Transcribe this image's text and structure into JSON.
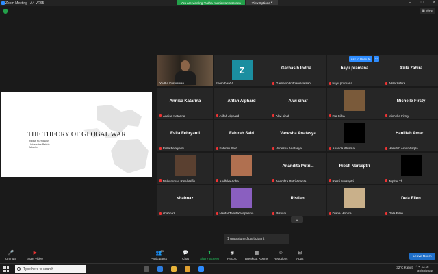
{
  "window": {
    "title": "Zoom Meeting - A4-VR65"
  },
  "banner": {
    "viewing": "You are viewing Yudha Kurniawan's screen",
    "view_options": "View Options"
  },
  "window_controls": {
    "minimize": "–",
    "maximize": "□",
    "close": "×"
  },
  "top_right": {
    "view_label": "View"
  },
  "slide": {
    "title": "THE THEORY OF GLOBAL WAR",
    "author_lines": [
      "Yudha Kurniawan",
      "Universitas Bakrie",
      "Jakarta"
    ]
  },
  "participants": [
    {
      "display": "",
      "label": "Yudha Kurniawan",
      "muted": false,
      "kind": "video",
      "active": true
    },
    {
      "display": "Z",
      "label": "zoom baa04",
      "muted": false,
      "kind": "avatar"
    },
    {
      "display": "Garnasih Indria...",
      "label": "Garnasih Indriani Hafsah",
      "muted": true,
      "kind": "name"
    },
    {
      "display": "bayu pramana",
      "label": "bayu pramana",
      "muted": true,
      "kind": "name"
    },
    {
      "display": "Azila Zahira",
      "label": "Azila Zahira",
      "muted": true,
      "kind": "name"
    },
    {
      "display": "Annisa Katarina",
      "label": "Annisa Katarina",
      "muted": true,
      "kind": "name"
    },
    {
      "display": "Afifah Alphard",
      "label": "Afifah Alphard",
      "muted": true,
      "kind": "name"
    },
    {
      "display": "Alwi sihaf",
      "label": "Alwi sihaf",
      "muted": true,
      "kind": "name"
    },
    {
      "display": "",
      "label": "Ria Silva",
      "muted": true,
      "kind": "photo",
      "photo": "#7a5a3a"
    },
    {
      "display": "Michelle Firsty",
      "label": "Michelle Firsty",
      "muted": true,
      "kind": "name"
    },
    {
      "display": "Evita Febryanti",
      "label": "Evita Febryanti",
      "muted": true,
      "kind": "name"
    },
    {
      "display": "Fahirah Said",
      "label": "Fahirah Said",
      "muted": true,
      "kind": "name"
    },
    {
      "display": "Vanesha Anatasya",
      "label": "Vanesha Anatasya",
      "muted": true,
      "kind": "name"
    },
    {
      "display": "",
      "label": "Ananda Wilama",
      "muted": true,
      "kind": "photo",
      "photo": "#000000"
    },
    {
      "display": "Haniifah Amar...",
      "label": "Haniifah Amar Aaqila",
      "muted": true,
      "kind": "name"
    },
    {
      "display": "",
      "label": "Muhammad Risal Arifin",
      "muted": true,
      "kind": "photo",
      "photo": "#5a4030"
    },
    {
      "display": "",
      "label": "Andhika Adha",
      "muted": true,
      "kind": "photo",
      "photo": "#b07050"
    },
    {
      "display": "Anandita Putri...",
      "label": "Anandita Putri Ananta",
      "muted": true,
      "kind": "name"
    },
    {
      "display": "Riesfi Norseptri",
      "label": "Riesfi Norseptri",
      "muted": true,
      "kind": "name"
    },
    {
      "display": "",
      "label": "Jupiter Th",
      "muted": true,
      "kind": "photo",
      "photo": "#000000"
    },
    {
      "display": "shahnaz",
      "label": "shahnaz",
      "muted": true,
      "kind": "name"
    },
    {
      "display": "",
      "label": "Naufal Tasrif Karepesina",
      "muted": true,
      "kind": "photo",
      "photo": "#8a5fc0"
    },
    {
      "display": "Ristiani",
      "label": "Ristiani",
      "muted": true,
      "kind": "name"
    },
    {
      "display": "",
      "label": "Diana Monica",
      "muted": true,
      "kind": "photo",
      "photo": "#c9b08a"
    },
    {
      "display": "Dela Eilen",
      "label": "Dela Eilen",
      "muted": true,
      "kind": "name"
    }
  ],
  "hover": {
    "ask_unmute": "Ask to Unmute",
    "more": "···"
  },
  "unassigned": "1 unassigned participant",
  "toolbar": {
    "unmute": "Unmute",
    "start_video": "Start Video",
    "participants": "Participants",
    "participants_count": "39",
    "chat": "Chat",
    "share_screen": "Share Screen",
    "record": "Record",
    "breakout_rooms": "Breakout Rooms",
    "reactions": "Reactions",
    "apps": "Apps",
    "leave": "Leave Room"
  },
  "taskbar": {
    "search_placeholder": "Type here to search",
    "weather": "32°C  Kabut",
    "time": "13:16",
    "date": "30/03/2022"
  },
  "colors": {
    "accent": "#2d8cff",
    "active_speaker": "#c9e265",
    "banner": "#23a04a",
    "leave": "#1f6fc9"
  }
}
